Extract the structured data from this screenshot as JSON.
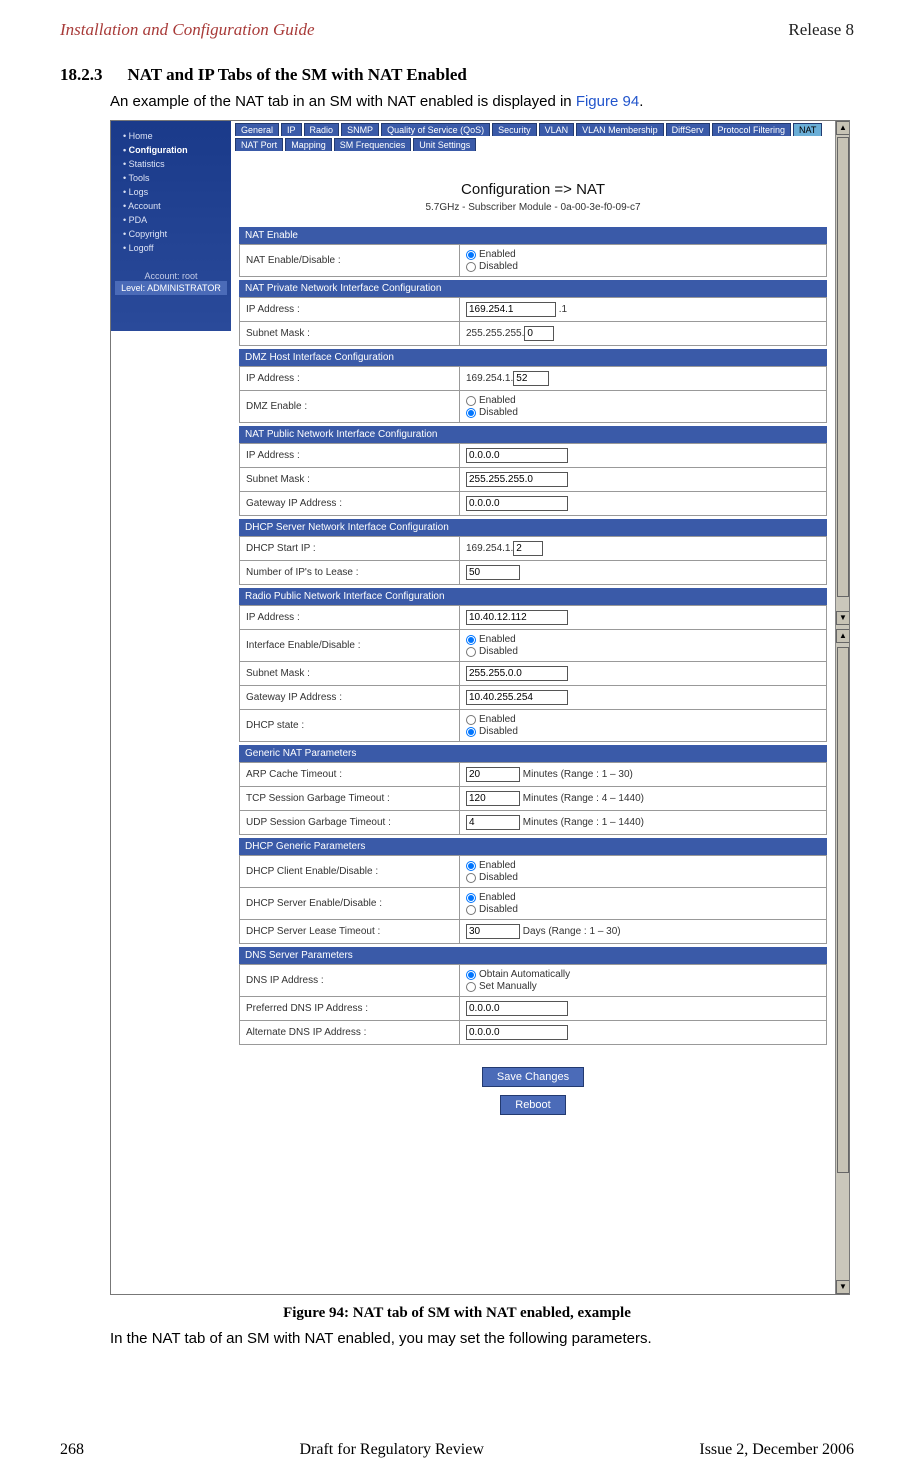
{
  "header": {
    "left": "Installation and Configuration Guide",
    "right": "Release 8"
  },
  "section": {
    "number": "18.2.3",
    "title": "NAT and IP Tabs of the SM with NAT Enabled",
    "intro_before": "An example of the NAT tab in an SM with NAT enabled is displayed in ",
    "intro_ref": "Figure 94",
    "intro_after": "."
  },
  "sidebar": {
    "items": [
      "Home",
      "Configuration",
      "Statistics",
      "Tools",
      "Logs",
      "Account",
      "PDA",
      "Copyright",
      "Logoff"
    ],
    "account_label": "Account: root",
    "level_label": "Level: ADMINISTRATOR"
  },
  "tabs": {
    "row1": [
      "General",
      "IP",
      "Radio",
      "SNMP",
      "Quality of Service (QoS)",
      "Security",
      "VLAN",
      "VLAN Membership",
      "DiffServ",
      "Protocol Filtering",
      "NAT",
      "NAT Port"
    ],
    "row2": [
      "Mapping",
      "SM Frequencies",
      "Unit Settings"
    ]
  },
  "page_title": "Configuration => NAT",
  "page_subtitle": "5.7GHz - Subscriber Module - 0a-00-3e-f0-09-c7",
  "panels": {
    "nat_enable": {
      "title": "NAT Enable",
      "row_label": "NAT Enable/Disable :",
      "opt_enabled": "Enabled",
      "opt_disabled": "Disabled"
    },
    "nat_private": {
      "title": "NAT Private Network Interface Configuration",
      "ip_label": "IP Address :",
      "ip_value": "169.254.1",
      "ip_suffix": ".1",
      "subnet_label": "Subnet Mask :",
      "subnet_prefix": "255.255.255.",
      "subnet_value": "0"
    },
    "dmz": {
      "title": "DMZ Host Interface Configuration",
      "ip_label": "IP Address :",
      "ip_prefix": "169.254.1.",
      "ip_value": "52",
      "enable_label": "DMZ Enable :",
      "opt_enabled": "Enabled",
      "opt_disabled": "Disabled"
    },
    "nat_public": {
      "title": "NAT Public Network Interface Configuration",
      "ip_label": "IP Address :",
      "ip_value": "0.0.0.0",
      "subnet_label": "Subnet Mask :",
      "subnet_value": "255.255.255.0",
      "gw_label": "Gateway IP Address :",
      "gw_value": "0.0.0.0"
    },
    "dhcp_server": {
      "title": "DHCP Server Network Interface Configuration",
      "start_label": "DHCP Start IP :",
      "start_prefix": "169.254.1.",
      "start_value": "2",
      "lease_label": "Number of IP's to Lease :",
      "lease_value": "50"
    },
    "radio_public": {
      "title": "Radio Public Network Interface Configuration",
      "ip_label": "IP Address :",
      "ip_value": "10.40.12.112",
      "iface_label": "Interface Enable/Disable :",
      "opt_enabled": "Enabled",
      "opt_disabled": "Disabled",
      "subnet_label": "Subnet Mask :",
      "subnet_value": "255.255.0.0",
      "gw_label": "Gateway IP Address :",
      "gw_value": "10.40.255.254",
      "dhcp_label": "DHCP state :",
      "dhcp_enabled": "Enabled",
      "dhcp_disabled": "Disabled"
    },
    "generic_nat": {
      "title": "Generic NAT Parameters",
      "arp_label": "ARP Cache Timeout :",
      "arp_value": "20",
      "arp_suffix": "Minutes (Range : 1 – 30)",
      "tcp_label": "TCP Session Garbage Timeout :",
      "tcp_value": "120",
      "tcp_suffix": "Minutes (Range : 4 – 1440)",
      "udp_label": "UDP Session Garbage Timeout :",
      "udp_value": "4",
      "udp_suffix": "Minutes (Range : 1 – 1440)"
    },
    "dhcp_generic": {
      "title": "DHCP Generic Parameters",
      "client_label": "DHCP Client Enable/Disable :",
      "server_label": "DHCP Server Enable/Disable :",
      "opt_enabled": "Enabled",
      "opt_disabled": "Disabled",
      "lease_label": "DHCP Server Lease Timeout :",
      "lease_value": "30",
      "lease_suffix": "Days (Range : 1 – 30)"
    },
    "dns": {
      "title": "DNS Server Parameters",
      "dns_ip_label": "DNS IP Address :",
      "opt_auto": "Obtain Automatically",
      "opt_manual": "Set Manually",
      "pref_label": "Preferred DNS IP Address :",
      "pref_value": "0.0.0.0",
      "alt_label": "Alternate DNS IP Address :",
      "alt_value": "0.0.0.0"
    }
  },
  "buttons": {
    "save": "Save Changes",
    "reboot": "Reboot"
  },
  "caption": "Figure 94: NAT tab of SM with NAT enabled, example",
  "aftertext": "In the NAT tab of an SM with NAT enabled, you may set the following parameters.",
  "footer": {
    "page": "268",
    "center": "Draft for Regulatory Review",
    "right": "Issue 2, December 2006"
  }
}
